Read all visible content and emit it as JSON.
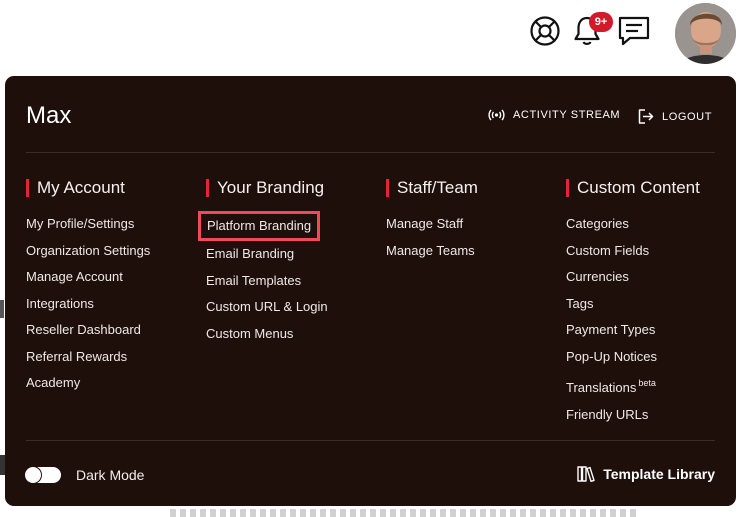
{
  "header": {
    "notification_badge": "9+",
    "icons": [
      "lifebuoy-icon",
      "bell-icon",
      "chat-icon"
    ]
  },
  "panel": {
    "user_name": "Max",
    "activity_stream_label": "ACTIVITY STREAM",
    "logout_label": "LOGOUT",
    "columns": [
      {
        "title": "My Account",
        "items": [
          "My Profile/Settings",
          "Organization Settings",
          "Manage Account",
          "Integrations",
          "Reseller Dashboard",
          "Referral Rewards",
          "Academy"
        ]
      },
      {
        "title": "Your Branding",
        "items": [
          "Platform Branding",
          "Email Branding",
          "Email Templates",
          "Custom URL & Login",
          "Custom Menus"
        ]
      },
      {
        "title": "Staff/Team",
        "items": [
          "Manage Staff",
          "Manage Teams"
        ]
      },
      {
        "title": "Custom Content",
        "items": [
          "Categories",
          "Custom Fields",
          "Currencies",
          "Tags",
          "Payment Types",
          "Pop-Up Notices",
          "Translations",
          "Friendly URLs"
        ],
        "translations_sup": "beta"
      }
    ],
    "footer": {
      "dark_mode_label": "Dark Mode",
      "dark_mode_on": false,
      "template_library_label": "Template Library"
    }
  },
  "colors": {
    "panel_bg": "#1e0f0b",
    "accent": "#e32636",
    "highlight_border": "#ee4b57",
    "badge": "#d11a2a"
  }
}
